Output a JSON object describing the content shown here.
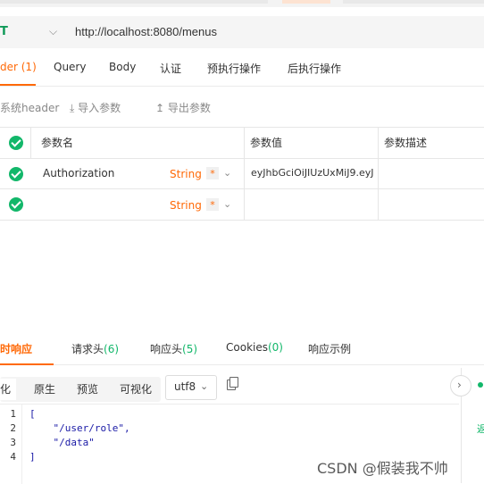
{
  "request": {
    "method": "T",
    "url": "http://localhost:8080/menus"
  },
  "req_tabs": [
    {
      "label": "der (1)"
    },
    {
      "label": "Query"
    },
    {
      "label": "Body"
    },
    {
      "label": "认证"
    },
    {
      "label": "预执行操作"
    },
    {
      "label": "后执行操作"
    }
  ],
  "toolbar": {
    "sys_header": "系统header",
    "import": "导入参数",
    "export": "导出参数"
  },
  "table": {
    "headers": {
      "name": "参数名",
      "value": "参数值",
      "desc": "参数描述"
    },
    "rows": [
      {
        "name": "Authorization",
        "type": "String",
        "required": "*",
        "value": "eyJhbGciOiJIUzUxMiJ9.eyJ",
        "desc": ""
      },
      {
        "name": "",
        "type": "String",
        "required": "*",
        "value": "",
        "desc": ""
      }
    ]
  },
  "response": {
    "tabs": {
      "realtime": "时响应",
      "req_headers_label": "请求头",
      "req_headers_count": "(6)",
      "resp_headers_label": "响应头",
      "resp_headers_count": "(5)",
      "cookies_label": "Cookies",
      "cookies_count": "(0)",
      "example": "响应示例"
    },
    "view_modes": [
      "化",
      "原生",
      "预览",
      "可视化"
    ],
    "encoding": "utf8",
    "line_numbers": [
      "1",
      "2",
      "3",
      "4"
    ],
    "code_lines": [
      "[",
      "    \"/user/role\",",
      "    \"/data\"",
      "]"
    ],
    "side_text": "返"
  },
  "watermark": "CSDN @假装我不帅",
  "colors": {
    "accent": "#ff6907",
    "green": "#12b76a"
  }
}
